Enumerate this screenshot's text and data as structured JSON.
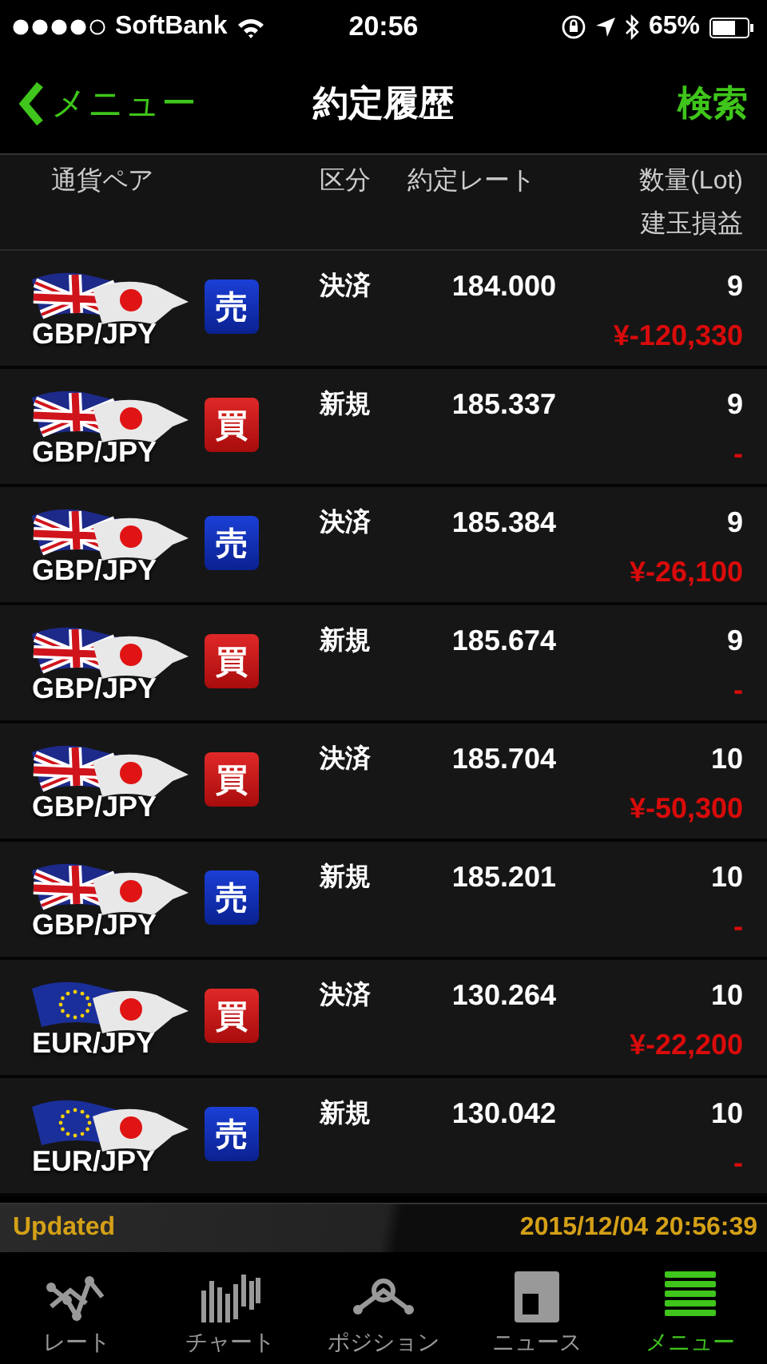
{
  "status_bar": {
    "carrier": "SoftBank",
    "time": "20:56",
    "battery": "65%"
  },
  "nav": {
    "back": "メニュー",
    "title": "約定履歴",
    "action": "検索"
  },
  "columns": {
    "pair": "通貨ペア",
    "type": "区分",
    "rate": "約定レート",
    "lots": "数量(Lot)",
    "pl": "建玉損益"
  },
  "rows": [
    {
      "kind": "gb",
      "pair": "GBP/JPY",
      "badge": {
        "kind": "sell",
        "label": "売"
      },
      "type": "決済",
      "rate": "184.000",
      "lots": "9",
      "pl": "¥-120,330"
    },
    {
      "kind": "gb",
      "pair": "GBP/JPY",
      "badge": {
        "kind": "buy",
        "label": "買"
      },
      "type": "新規",
      "rate": "185.337",
      "lots": "9",
      "pl": "-"
    },
    {
      "kind": "gb",
      "pair": "GBP/JPY",
      "badge": {
        "kind": "sell",
        "label": "売"
      },
      "type": "決済",
      "rate": "185.384",
      "lots": "9",
      "pl": "¥-26,100"
    },
    {
      "kind": "gb",
      "pair": "GBP/JPY",
      "badge": {
        "kind": "buy",
        "label": "買"
      },
      "type": "新規",
      "rate": "185.674",
      "lots": "9",
      "pl": "-"
    },
    {
      "kind": "gb",
      "pair": "GBP/JPY",
      "badge": {
        "kind": "buy",
        "label": "買"
      },
      "type": "決済",
      "rate": "185.704",
      "lots": "10",
      "pl": "¥-50,300"
    },
    {
      "kind": "gb",
      "pair": "GBP/JPY",
      "badge": {
        "kind": "sell",
        "label": "売"
      },
      "type": "新規",
      "rate": "185.201",
      "lots": "10",
      "pl": "-"
    },
    {
      "kind": "eu",
      "pair": "EUR/JPY",
      "badge": {
        "kind": "buy",
        "label": "買"
      },
      "type": "決済",
      "rate": "130.264",
      "lots": "10",
      "pl": "¥-22,200"
    },
    {
      "kind": "eu",
      "pair": "EUR/JPY",
      "badge": {
        "kind": "sell",
        "label": "売"
      },
      "type": "新規",
      "rate": "130.042",
      "lots": "10",
      "pl": "-"
    }
  ],
  "updated": {
    "label": "Updated",
    "timestamp": "2015/12/04 20:56:39"
  },
  "tabs": [
    {
      "label": "レート",
      "selected": false
    },
    {
      "label": "チャート",
      "selected": false
    },
    {
      "label": "ポジション",
      "selected": false
    },
    {
      "label": "ニュース",
      "selected": false
    },
    {
      "label": "メニュー",
      "selected": true
    }
  ]
}
